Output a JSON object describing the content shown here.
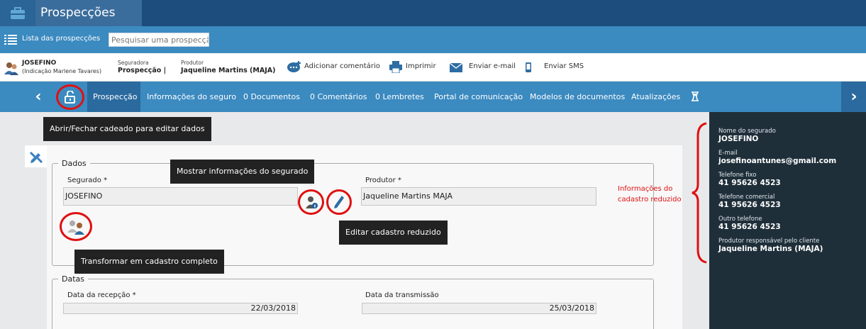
{
  "app": {
    "title": "Prospecções"
  },
  "bar2": {
    "list_label": "Lista das prospecções",
    "search_placeholder": "Pesquisar uma prospecção"
  },
  "info": {
    "name": "JOSEFINO",
    "indication": "(Indicação Marlene Tavares)",
    "insurer_label": "Seguradora",
    "insurer_value": "Prospecção |",
    "producer_label": "Produtor",
    "producer_value": "Jaqueline Martins (MAJA)",
    "actions": {
      "comment": "Adicionar comentário",
      "print": "Imprimir",
      "email": "Enviar e-mail",
      "sms": "Enviar SMS"
    }
  },
  "nav": {
    "tabs": [
      "Prospecção",
      "Informações do seguro",
      "0 Documentos",
      "0 Comentários",
      "0 Lembretes",
      "Portal de comunicação",
      "Modelos de documentos",
      "Atualizações"
    ]
  },
  "tooltips": {
    "lock": "Abrir/Fechar cadeado para editar dados",
    "show_insured": "Mostrar informações do segurado",
    "edit_reduced": "Editar cadastro reduzido",
    "transform": "Transformar em cadastro completo"
  },
  "dados": {
    "legend": "Dados",
    "segurado_label": "Segurado *",
    "segurado_value": "JOSEFINO",
    "produtor_label": "Produtor *",
    "produtor_value": "Jaqueline Martins MAJA"
  },
  "datas": {
    "legend": "Datas",
    "recepcao_label": "Data da recepção *",
    "recepcao_value": "22/03/2018",
    "transmissao_label": "Data da transmissão",
    "transmissao_value": "25/03/2018"
  },
  "side": {
    "nome_label": "Nome do segurado",
    "nome_value": "JOSEFINO",
    "email_label": "E-mail",
    "email_value": "josefinoantunes@gmail.com",
    "tel_fixo_label": "Telefone fixo",
    "tel_fixo_value": "41 95626 4523",
    "tel_com_label": "Telefone comercial",
    "tel_com_value": "41 95626 4523",
    "outro_label": "Outro telefone",
    "outro_value": "41 95626 4523",
    "prod_label": "Produtor responsável pelo cliente",
    "prod_value": "Jaqueline Martins (MAJA)"
  },
  "annotation": {
    "line1": "Informações do",
    "line2": "cadastro reduzido"
  },
  "colors": {
    "highlight": "#e01010",
    "nav": "#3b8ac0",
    "top": "#1d4d7c",
    "side_panel": "#1f2f3a"
  }
}
